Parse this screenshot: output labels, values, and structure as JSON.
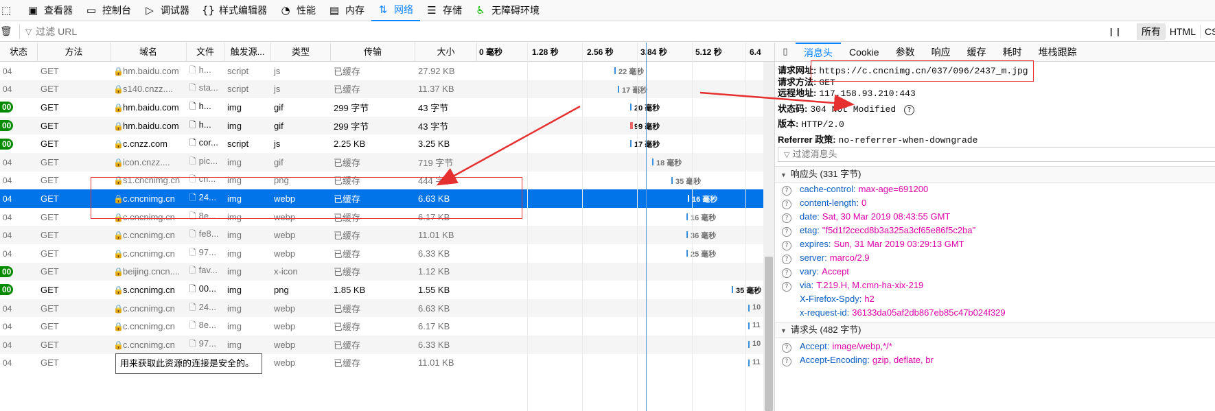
{
  "toolbar": {
    "tabs": [
      {
        "label": "查看器",
        "icon": "inspector-icon"
      },
      {
        "label": "控制台",
        "icon": "console-icon"
      },
      {
        "label": "调试器",
        "icon": "debugger-icon"
      },
      {
        "label": "样式编辑器",
        "icon": "style-editor-icon"
      },
      {
        "label": "性能",
        "icon": "performance-icon"
      },
      {
        "label": "内存",
        "icon": "memory-icon"
      },
      {
        "label": "网络",
        "icon": "network-icon"
      },
      {
        "label": "存储",
        "icon": "storage-icon"
      },
      {
        "label": "无障碍环境",
        "icon": "accessibility-icon"
      }
    ],
    "active": "网络"
  },
  "filter": {
    "placeholder": "过滤 URL",
    "type_buttons": [
      "所有",
      "HTML",
      "CS"
    ]
  },
  "table": {
    "headers": [
      "状态",
      "方法",
      "域名",
      "文件",
      "触发源...",
      "类型",
      "传输",
      "大小"
    ],
    "timeline_ticks": [
      "0 毫秒",
      "1.28 秒",
      "2.56 秒",
      "3.84 秒",
      "5.12 秒",
      "6.4"
    ],
    "rows": [
      {
        "status": "04",
        "method": "GET",
        "domain": "hm.baidu.com",
        "file": "h...",
        "cause": "script",
        "type": "js",
        "transferred": "已缓存",
        "size": "27.92 KB",
        "timing": "22 毫秒",
        "cached": true
      },
      {
        "status": "04",
        "method": "GET",
        "domain": "s140.cnzz....",
        "file": "sta...",
        "cause": "script",
        "type": "js",
        "transferred": "已缓存",
        "size": "11.37 KB",
        "timing": "17 毫秒",
        "cached": true
      },
      {
        "status": "00",
        "method": "GET",
        "domain": "hm.baidu.com",
        "file": "h...",
        "cause": "img",
        "type": "gif",
        "transferred": "299 字节",
        "size": "43 字节",
        "timing": "20 毫秒",
        "cached": false
      },
      {
        "status": "00",
        "method": "GET",
        "domain": "hm.baidu.com",
        "file": "h...",
        "cause": "img",
        "type": "gif",
        "transferred": "299 字节",
        "size": "43 字节",
        "timing": "99 毫秒",
        "cached": false
      },
      {
        "status": "00",
        "method": "GET",
        "domain": "c.cnzz.com",
        "file": "cor...",
        "cause": "script",
        "type": "js",
        "transferred": "2.25 KB",
        "size": "3.25 KB",
        "timing": "17 毫秒",
        "cached": false
      },
      {
        "status": "04",
        "method": "GET",
        "domain": "icon.cnzz....",
        "file": "pic...",
        "cause": "img",
        "type": "gif",
        "transferred": "已缓存",
        "size": "719 字节",
        "timing": "18 毫秒",
        "cached": true
      },
      {
        "status": "04",
        "method": "GET",
        "domain": "s1.cncnimg.cn",
        "file": "cn...",
        "cause": "img",
        "type": "png",
        "transferred": "已缓存",
        "size": "444 字节",
        "timing": "35 毫秒",
        "cached": true
      },
      {
        "status": "04",
        "method": "GET",
        "domain": "c.cncnimg.cn",
        "file": "24...",
        "cause": "img",
        "type": "webp",
        "transferred": "已缓存",
        "size": "6.63 KB",
        "timing": "16 毫秒",
        "cached": true,
        "selected": true
      },
      {
        "status": "04",
        "method": "GET",
        "domain": "c.cncnimg.cn",
        "file": "8e...",
        "cause": "img",
        "type": "webp",
        "transferred": "已缓存",
        "size": "6.17 KB",
        "timing": "16 毫秒",
        "cached": true
      },
      {
        "status": "04",
        "method": "GET",
        "domain": "c.cncnimg.cn",
        "file": "fe8...",
        "cause": "img",
        "type": "webp",
        "transferred": "已缓存",
        "size": "11.01 KB",
        "timing": "36 毫秒",
        "cached": true
      },
      {
        "status": "04",
        "method": "GET",
        "domain": "c.cncnimg.cn",
        "file": "97...",
        "cause": "img",
        "type": "webp",
        "transferred": "已缓存",
        "size": "6.33 KB",
        "timing": "25 毫秒",
        "cached": true
      },
      {
        "status": "00",
        "method": "GET",
        "domain": "beijing.cncn....",
        "file": "fav...",
        "cause": "img",
        "type": "x-icon",
        "transferred": "已缓存",
        "size": "1.12 KB",
        "timing": "",
        "cached": true
      },
      {
        "status": "00",
        "method": "GET",
        "domain": "s.cncnimg.cn",
        "file": "00...",
        "cause": "img",
        "type": "png",
        "transferred": "1.85 KB",
        "size": "1.55 KB",
        "timing": "35 毫秒",
        "cached": false
      },
      {
        "status": "04",
        "method": "GET",
        "domain": "c.cncnimg.cn",
        "file": "24...",
        "cause": "img",
        "type": "webp",
        "transferred": "已缓存",
        "size": "6.63 KB",
        "timing": "10",
        "cached": true
      },
      {
        "status": "04",
        "method": "GET",
        "domain": "c.cncnimg.cn",
        "file": "8e...",
        "cause": "img",
        "type": "webp",
        "transferred": "已缓存",
        "size": "6.17 KB",
        "timing": "11",
        "cached": true
      },
      {
        "status": "04",
        "method": "GET",
        "domain": "c.cncnimg.cn",
        "file": "97...",
        "cause": "img",
        "type": "webp",
        "transferred": "已缓存",
        "size": "6.33 KB",
        "timing": "10",
        "cached": true
      },
      {
        "status": "04",
        "method": "GET",
        "domain": "",
        "file": "",
        "cause": "",
        "type": "webp",
        "transferred": "已缓存",
        "size": "11.01 KB",
        "timing": "11",
        "cached": true
      }
    ]
  },
  "tooltip": "用来获取此资源的连接是安全的。",
  "panel": {
    "tabs": [
      "消息头",
      "Cookie",
      "参数",
      "响应",
      "缓存",
      "耗时",
      "堆栈跟踪"
    ],
    "active_tab": "消息头",
    "request_url_label": "请求网址:",
    "request_url": "https://c.cncnimg.cn/037/096/2437_m.jpg",
    "method_label": "请求方法:",
    "method": "GET",
    "remote_label": "远程地址:",
    "remote": "117.158.93.210:443",
    "status_label": "状态码:",
    "status": "304  Not Modified",
    "version_label": "版本:",
    "version": "HTTP/2.0",
    "referrer_label": "Referrer 政策:",
    "referrer": "no-referrer-when-downgrade",
    "filter_placeholder": "过滤消息头",
    "response_section": "响应头 (331 字节)",
    "response_headers": [
      {
        "name": "cache-control:",
        "value": "max-age=691200"
      },
      {
        "name": "content-length:",
        "value": "0"
      },
      {
        "name": "date:",
        "value": "Sat, 30 Mar 2019 08:43:55 GMT"
      },
      {
        "name": "etag:",
        "value": "\"f5d1f2cecd8b3a325a3cf65e86f5c2ba\""
      },
      {
        "name": "expires:",
        "value": "Sun, 31 Mar 2019 03:29:13 GMT"
      },
      {
        "name": "server:",
        "value": "marco/2.9"
      },
      {
        "name": "vary:",
        "value": "Accept"
      },
      {
        "name": "via:",
        "value": "T.219.H, M.cmn-ha-xix-219"
      },
      {
        "name": "X-Firefox-Spdy:",
        "value": "h2"
      },
      {
        "name": "x-request-id:",
        "value": "36133da05af2db867eb85c47b024f329"
      }
    ],
    "request_section": "请求头 (482 字节)",
    "request_headers": [
      {
        "name": "Accept:",
        "value": "image/webp,*/*"
      },
      {
        "name": "Accept-Encoding:",
        "value": "gzip, deflate, br"
      }
    ]
  },
  "colors": {
    "accent": "#0a84ff",
    "selected_row": "#0074e8",
    "status_ok": "#058b00",
    "annotation": "#e63030",
    "header_value": "#dd00a9"
  }
}
